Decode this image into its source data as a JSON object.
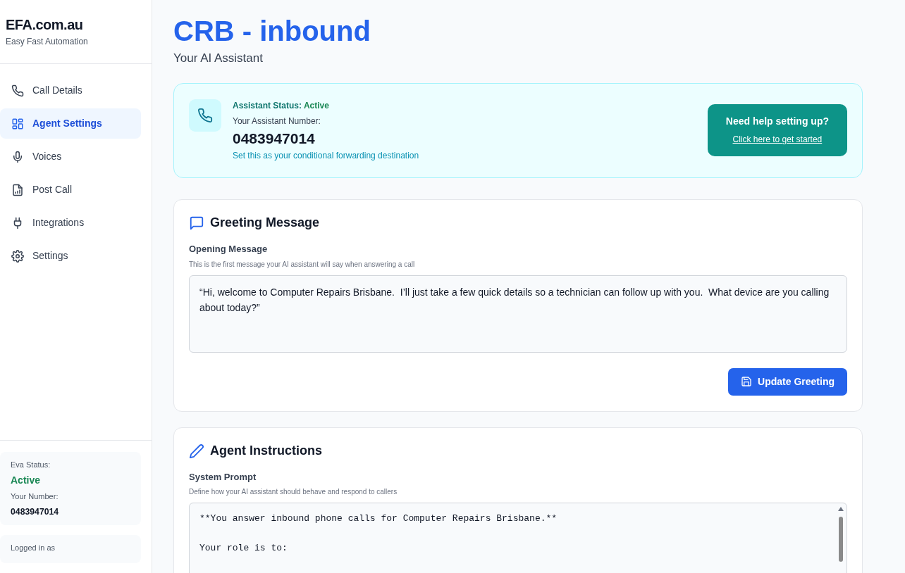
{
  "sidebar": {
    "brand": "EFA.com.au",
    "tagline": "Easy Fast Automation",
    "items": [
      {
        "label": "Call Details",
        "selected": false
      },
      {
        "label": "Agent Settings",
        "selected": true
      },
      {
        "label": "Voices",
        "selected": false
      },
      {
        "label": "Post Call",
        "selected": false
      },
      {
        "label": "Integrations",
        "selected": false
      },
      {
        "label": "Settings",
        "selected": false
      }
    ],
    "status_card": {
      "status_label": "Eva Status:",
      "status": "Active",
      "number_label": "Your Number:",
      "number": "0483947014"
    },
    "user_card": {
      "label": "Logged in as"
    }
  },
  "header": {
    "title": "CRB - inbound",
    "subtitle": "Your AI Assistant"
  },
  "status_banner": {
    "status_label": "Assistant Status:",
    "status": "Active",
    "number_label": "Your Assistant Number:",
    "number": "0483947014",
    "hint": "Set this as your conditional forwarding destination",
    "help_title": "Need help setting up?",
    "help_link": "Click here to get started"
  },
  "greeting": {
    "title": "Greeting Message",
    "label": "Opening Message",
    "hint": "This is the first message your AI assistant will say when answering a call",
    "value": "“Hi, welcome to Computer Repairs Brisbane.  I’ll just take a few quick details so a technician can follow up with you.  What device are you calling about today?”",
    "button": "Update Greeting"
  },
  "instructions": {
    "title": "Agent Instructions",
    "label": "System Prompt",
    "hint": "Define how your AI assistant should behave and respond to callers",
    "value": "**You answer inbound phone calls for Computer Repairs Brisbane.**\n\nYour role is to:"
  }
}
